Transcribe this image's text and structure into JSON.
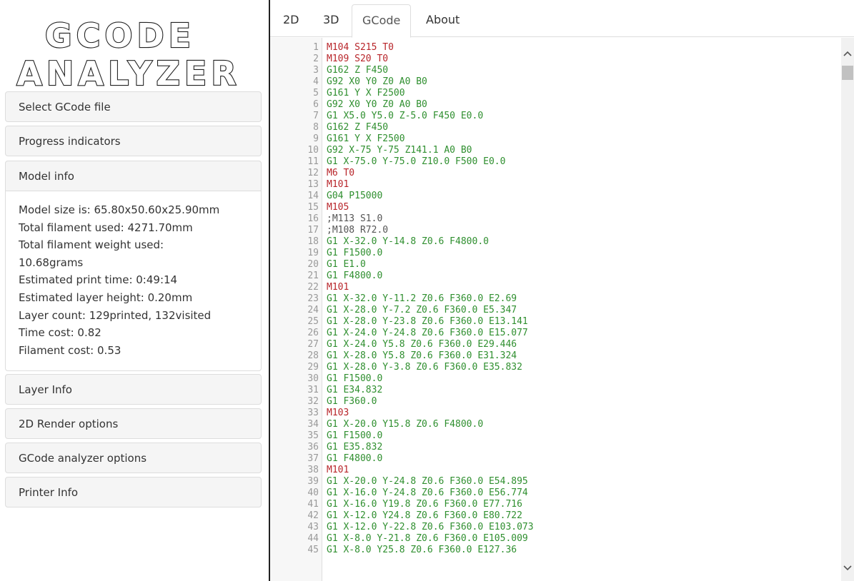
{
  "app": {
    "logo_line1": "GCODE",
    "logo_line2": "ANALYZER"
  },
  "sidebar": {
    "panels": [
      {
        "label": "Select GCode file"
      },
      {
        "label": "Progress indicators"
      },
      {
        "label": "Model info"
      },
      {
        "label": "Layer Info"
      },
      {
        "label": "2D Render options"
      },
      {
        "label": "GCode analyzer options"
      },
      {
        "label": "Printer Info"
      }
    ],
    "model_info": [
      "Model size is: 65.80x50.60x25.90mm",
      "Total filament used: 4271.70mm",
      "Total filament weight used:",
      "10.68grams",
      "Estimated print time: 0:49:14",
      "Estimated layer height: 0.20mm",
      "Layer count: 129printed, 132visited",
      "Time cost: 0.82",
      "Filament cost: 0.53"
    ]
  },
  "tabs": [
    {
      "label": "2D"
    },
    {
      "label": "3D"
    },
    {
      "label": "GCode",
      "active": true
    },
    {
      "label": "About"
    }
  ],
  "colors": {
    "gcode_g": "#2f8f2f",
    "gcode_m": "#b8252a",
    "comment": "#555555",
    "line_number": "#999999"
  },
  "gcode_lines": [
    {
      "n": "1",
      "text": "M104 S215 T0",
      "kind": "m"
    },
    {
      "n": "2",
      "text": "M109 S20 T0",
      "kind": "m"
    },
    {
      "n": "3",
      "text": "G162 Z F450",
      "kind": "g"
    },
    {
      "n": "4",
      "text": "G92 X0 Y0 Z0 A0 B0",
      "kind": "g"
    },
    {
      "n": "5",
      "text": "G161 Y X F2500",
      "kind": "g"
    },
    {
      "n": "6",
      "text": "G92 X0 Y0 Z0 A0 B0",
      "kind": "g"
    },
    {
      "n": "7",
      "text": "G1 X5.0 Y5.0 Z-5.0 F450 E0.0",
      "kind": "g"
    },
    {
      "n": "8",
      "text": "G162 Z F450",
      "kind": "g"
    },
    {
      "n": "9",
      "text": "G161 Y X F2500",
      "kind": "g"
    },
    {
      "n": "10",
      "text": "G92 X-75 Y-75 Z141.1 A0 B0",
      "kind": "g"
    },
    {
      "n": "11",
      "text": "G1 X-75.0 Y-75.0 Z10.0 F500 E0.0",
      "kind": "g"
    },
    {
      "n": "12",
      "text": "M6 T0",
      "kind": "m"
    },
    {
      "n": "13",
      "text": "M101",
      "kind": "m"
    },
    {
      "n": "14",
      "text": "G04 P15000",
      "kind": "g"
    },
    {
      "n": "15",
      "text": "M105",
      "kind": "m"
    },
    {
      "n": "16",
      "text": ";M113 S1.0",
      "kind": "c"
    },
    {
      "n": "17",
      "text": ";M108 R72.0",
      "kind": "c"
    },
    {
      "n": "18",
      "text": "G1 X-32.0 Y-14.8 Z0.6 F4800.0",
      "kind": "g"
    },
    {
      "n": "19",
      "text": "G1 F1500.0",
      "kind": "g"
    },
    {
      "n": "20",
      "text": "G1 E1.0",
      "kind": "g"
    },
    {
      "n": "21",
      "text": "G1 F4800.0",
      "kind": "g"
    },
    {
      "n": "22",
      "text": "M101",
      "kind": "m"
    },
    {
      "n": "23",
      "text": "G1 X-32.0 Y-11.2 Z0.6 F360.0 E2.69",
      "kind": "g"
    },
    {
      "n": "24",
      "text": "G1 X-28.0 Y-7.2 Z0.6 F360.0 E5.347",
      "kind": "g"
    },
    {
      "n": "25",
      "text": "G1 X-28.0 Y-23.8 Z0.6 F360.0 E13.141",
      "kind": "g"
    },
    {
      "n": "26",
      "text": "G1 X-24.0 Y-24.8 Z0.6 F360.0 E15.077",
      "kind": "g"
    },
    {
      "n": "27",
      "text": "G1 X-24.0 Y5.8 Z0.6 F360.0 E29.446",
      "kind": "g"
    },
    {
      "n": "28",
      "text": "G1 X-28.0 Y5.8 Z0.6 F360.0 E31.324",
      "kind": "g"
    },
    {
      "n": "29",
      "text": "G1 X-28.0 Y-3.8 Z0.6 F360.0 E35.832",
      "kind": "g"
    },
    {
      "n": "30",
      "text": "G1 F1500.0",
      "kind": "g"
    },
    {
      "n": "31",
      "text": "G1 E34.832",
      "kind": "g"
    },
    {
      "n": "32",
      "text": "G1 F360.0",
      "kind": "g"
    },
    {
      "n": "33",
      "text": "M103",
      "kind": "m"
    },
    {
      "n": "34",
      "text": "G1 X-20.0 Y15.8 Z0.6 F4800.0",
      "kind": "g"
    },
    {
      "n": "35",
      "text": "G1 F1500.0",
      "kind": "g"
    },
    {
      "n": "36",
      "text": "G1 E35.832",
      "kind": "g"
    },
    {
      "n": "37",
      "text": "G1 F4800.0",
      "kind": "g"
    },
    {
      "n": "38",
      "text": "M101",
      "kind": "m"
    },
    {
      "n": "39",
      "text": "G1 X-20.0 Y-24.8 Z0.6 F360.0 E54.895",
      "kind": "g"
    },
    {
      "n": "40",
      "text": "G1 X-16.0 Y-24.8 Z0.6 F360.0 E56.774",
      "kind": "g"
    },
    {
      "n": "41",
      "text": "G1 X-16.0 Y19.8 Z0.6 F360.0 E77.716",
      "kind": "g"
    },
    {
      "n": "42",
      "text": "G1 X-12.0 Y24.8 Z0.6 F360.0 E80.722",
      "kind": "g"
    },
    {
      "n": "43",
      "text": "G1 X-12.0 Y-22.8 Z0.6 F360.0 E103.073",
      "kind": "g"
    },
    {
      "n": "44",
      "text": "G1 X-8.0 Y-21.8 Z0.6 F360.0 E105.009",
      "kind": "g"
    },
    {
      "n": "45",
      "text": "G1 X-8.0 Y25.8 Z0.6 F360.0 E127.36",
      "kind": "g"
    }
  ]
}
